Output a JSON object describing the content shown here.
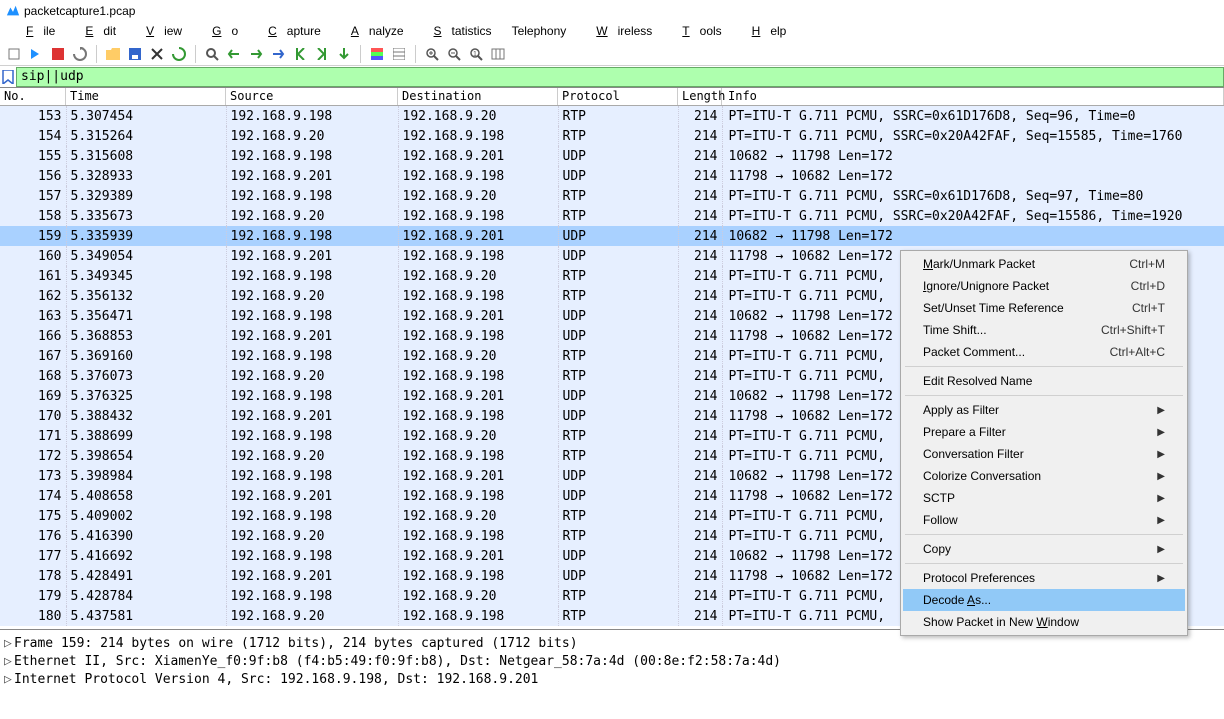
{
  "title": "packetcapture1.pcap",
  "menubar": [
    "File",
    "Edit",
    "View",
    "Go",
    "Capture",
    "Analyze",
    "Statistics",
    "Telephony",
    "Wireless",
    "Tools",
    "Help"
  ],
  "filter": "sip||udp",
  "columns": [
    "No.",
    "Time",
    "Source",
    "Destination",
    "Protocol",
    "Length",
    "Info"
  ],
  "selected_no": 159,
  "packets": [
    {
      "no": 153,
      "time": "5.307454",
      "src": "192.168.9.198",
      "dst": "192.168.9.20",
      "prot": "RTP",
      "len": 214,
      "info": "PT=ITU-T G.711 PCMU, SSRC=0x61D176D8, Seq=96, Time=0"
    },
    {
      "no": 154,
      "time": "5.315264",
      "src": "192.168.9.20",
      "dst": "192.168.9.198",
      "prot": "RTP",
      "len": 214,
      "info": "PT=ITU-T G.711 PCMU, SSRC=0x20A42FAF, Seq=15585, Time=1760"
    },
    {
      "no": 155,
      "time": "5.315608",
      "src": "192.168.9.198",
      "dst": "192.168.9.201",
      "prot": "UDP",
      "len": 214,
      "info": "10682 → 11798 Len=172"
    },
    {
      "no": 156,
      "time": "5.328933",
      "src": "192.168.9.201",
      "dst": "192.168.9.198",
      "prot": "UDP",
      "len": 214,
      "info": "11798 → 10682 Len=172"
    },
    {
      "no": 157,
      "time": "5.329389",
      "src": "192.168.9.198",
      "dst": "192.168.9.20",
      "prot": "RTP",
      "len": 214,
      "info": "PT=ITU-T G.711 PCMU, SSRC=0x61D176D8, Seq=97, Time=80"
    },
    {
      "no": 158,
      "time": "5.335673",
      "src": "192.168.9.20",
      "dst": "192.168.9.198",
      "prot": "RTP",
      "len": 214,
      "info": "PT=ITU-T G.711 PCMU, SSRC=0x20A42FAF, Seq=15586, Time=1920"
    },
    {
      "no": 159,
      "time": "5.335939",
      "src": "192.168.9.198",
      "dst": "192.168.9.201",
      "prot": "UDP",
      "len": 214,
      "info": "10682 → 11798 Len=172"
    },
    {
      "no": 160,
      "time": "5.349054",
      "src": "192.168.9.201",
      "dst": "192.168.9.198",
      "prot": "UDP",
      "len": 214,
      "info": "11798 → 10682 Len=172"
    },
    {
      "no": 161,
      "time": "5.349345",
      "src": "192.168.9.198",
      "dst": "192.168.9.20",
      "prot": "RTP",
      "len": 214,
      "info": "PT=ITU-T G.711 PCMU,"
    },
    {
      "no": 162,
      "time": "5.356132",
      "src": "192.168.9.20",
      "dst": "192.168.9.198",
      "prot": "RTP",
      "len": 214,
      "info": "PT=ITU-T G.711 PCMU,"
    },
    {
      "no": 163,
      "time": "5.356471",
      "src": "192.168.9.198",
      "dst": "192.168.9.201",
      "prot": "UDP",
      "len": 214,
      "info": "10682 → 11798 Len=172"
    },
    {
      "no": 166,
      "time": "5.368853",
      "src": "192.168.9.201",
      "dst": "192.168.9.198",
      "prot": "UDP",
      "len": 214,
      "info": "11798 → 10682 Len=172"
    },
    {
      "no": 167,
      "time": "5.369160",
      "src": "192.168.9.198",
      "dst": "192.168.9.20",
      "prot": "RTP",
      "len": 214,
      "info": "PT=ITU-T G.711 PCMU,"
    },
    {
      "no": 168,
      "time": "5.376073",
      "src": "192.168.9.20",
      "dst": "192.168.9.198",
      "prot": "RTP",
      "len": 214,
      "info": "PT=ITU-T G.711 PCMU,"
    },
    {
      "no": 169,
      "time": "5.376325",
      "src": "192.168.9.198",
      "dst": "192.168.9.201",
      "prot": "UDP",
      "len": 214,
      "info": "10682 → 11798 Len=172"
    },
    {
      "no": 170,
      "time": "5.388432",
      "src": "192.168.9.201",
      "dst": "192.168.9.198",
      "prot": "UDP",
      "len": 214,
      "info": "11798 → 10682 Len=172"
    },
    {
      "no": 171,
      "time": "5.388699",
      "src": "192.168.9.198",
      "dst": "192.168.9.20",
      "prot": "RTP",
      "len": 214,
      "info": "PT=ITU-T G.711 PCMU,"
    },
    {
      "no": 172,
      "time": "5.398654",
      "src": "192.168.9.20",
      "dst": "192.168.9.198",
      "prot": "RTP",
      "len": 214,
      "info": "PT=ITU-T G.711 PCMU,"
    },
    {
      "no": 173,
      "time": "5.398984",
      "src": "192.168.9.198",
      "dst": "192.168.9.201",
      "prot": "UDP",
      "len": 214,
      "info": "10682 → 11798 Len=172"
    },
    {
      "no": 174,
      "time": "5.408658",
      "src": "192.168.9.201",
      "dst": "192.168.9.198",
      "prot": "UDP",
      "len": 214,
      "info": "11798 → 10682 Len=172"
    },
    {
      "no": 175,
      "time": "5.409002",
      "src": "192.168.9.198",
      "dst": "192.168.9.20",
      "prot": "RTP",
      "len": 214,
      "info": "PT=ITU-T G.711 PCMU,"
    },
    {
      "no": 176,
      "time": "5.416390",
      "src": "192.168.9.20",
      "dst": "192.168.9.198",
      "prot": "RTP",
      "len": 214,
      "info": "PT=ITU-T G.711 PCMU,"
    },
    {
      "no": 177,
      "time": "5.416692",
      "src": "192.168.9.198",
      "dst": "192.168.9.201",
      "prot": "UDP",
      "len": 214,
      "info": "10682 → 11798 Len=172"
    },
    {
      "no": 178,
      "time": "5.428491",
      "src": "192.168.9.201",
      "dst": "192.168.9.198",
      "prot": "UDP",
      "len": 214,
      "info": "11798 → 10682 Len=172"
    },
    {
      "no": 179,
      "time": "5.428784",
      "src": "192.168.9.198",
      "dst": "192.168.9.20",
      "prot": "RTP",
      "len": 214,
      "info": "PT=ITU-T G.711 PCMU,"
    },
    {
      "no": 180,
      "time": "5.437581",
      "src": "192.168.9.20",
      "dst": "192.168.9.198",
      "prot": "RTP",
      "len": 214,
      "info": "PT=ITU-T G.711 PCMU,"
    }
  ],
  "details": [
    "Frame 159: 214 bytes on wire (1712 bits), 214 bytes captured (1712 bits)",
    "Ethernet II, Src: XiamenYe_f0:9f:b8 (f4:b5:49:f0:9f:b8), Dst: Netgear_58:7a:4d (00:8e:f2:58:7a:4d)",
    "Internet Protocol Version 4, Src: 192.168.9.198, Dst: 192.168.9.201"
  ],
  "ctxmenu": {
    "items": [
      {
        "label": "Mark/Unmark Packet",
        "accel": "Ctrl+M",
        "u": "M"
      },
      {
        "label": "Ignore/Unignore Packet",
        "accel": "Ctrl+D",
        "u": "I"
      },
      {
        "label": "Set/Unset Time Reference",
        "accel": "Ctrl+T"
      },
      {
        "label": "Time Shift...",
        "accel": "Ctrl+Shift+T"
      },
      {
        "label": "Packet Comment...",
        "accel": "Ctrl+Alt+C"
      },
      {
        "sep": true
      },
      {
        "label": "Edit Resolved Name"
      },
      {
        "sep": true
      },
      {
        "label": "Apply as Filter",
        "sub": true
      },
      {
        "label": "Prepare a Filter",
        "sub": true
      },
      {
        "label": "Conversation Filter",
        "sub": true
      },
      {
        "label": "Colorize Conversation",
        "sub": true
      },
      {
        "label": "SCTP",
        "sub": true
      },
      {
        "label": "Follow",
        "sub": true
      },
      {
        "sep": true
      },
      {
        "label": "Copy",
        "sub": true
      },
      {
        "sep": true
      },
      {
        "label": "Protocol Preferences",
        "sub": true
      },
      {
        "label": "Decode As...",
        "selected": true,
        "u": "A"
      },
      {
        "label": "Show Packet in New Window",
        "u": "W"
      }
    ]
  }
}
